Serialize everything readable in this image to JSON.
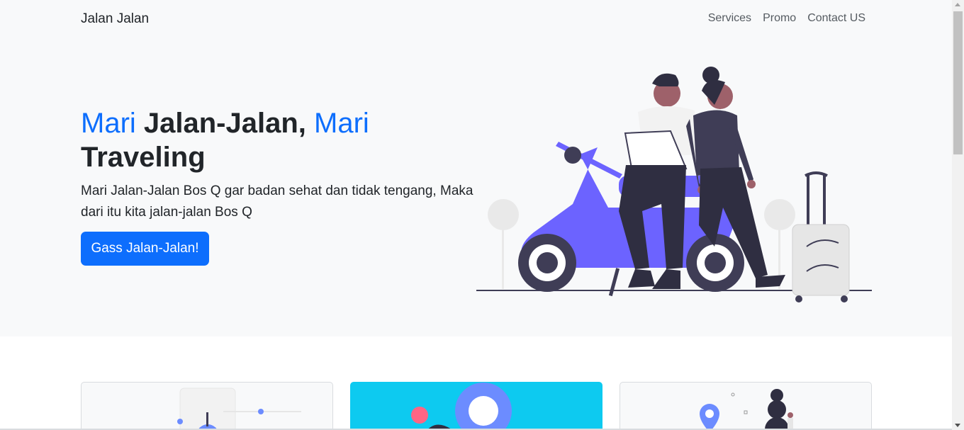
{
  "navbar": {
    "brand": "Jalan Jalan",
    "links": [
      "Services",
      "Promo",
      "Contact US"
    ]
  },
  "hero": {
    "title_word_1": "Mari",
    "title_word_2": " Jalan-Jalan, ",
    "title_word_3": "Mari",
    "title_word_4": " Traveling",
    "lead": "Mari Jalan-Jalan Bos Q gar badan sehat dan tidak tengang, Maka dari itu kita jalan-jalan Bos Q",
    "cta_label": "Gass Jalan-Jalan!"
  },
  "colors": {
    "primary": "#0d6efd",
    "hero_bg": "#f8f9fa",
    "scooter": "#6c63ff",
    "card_info": "#0dcaf0"
  },
  "icons": [
    "scooter-couple-illustration",
    "travel-card-illustration",
    "location-pin-illustration"
  ]
}
